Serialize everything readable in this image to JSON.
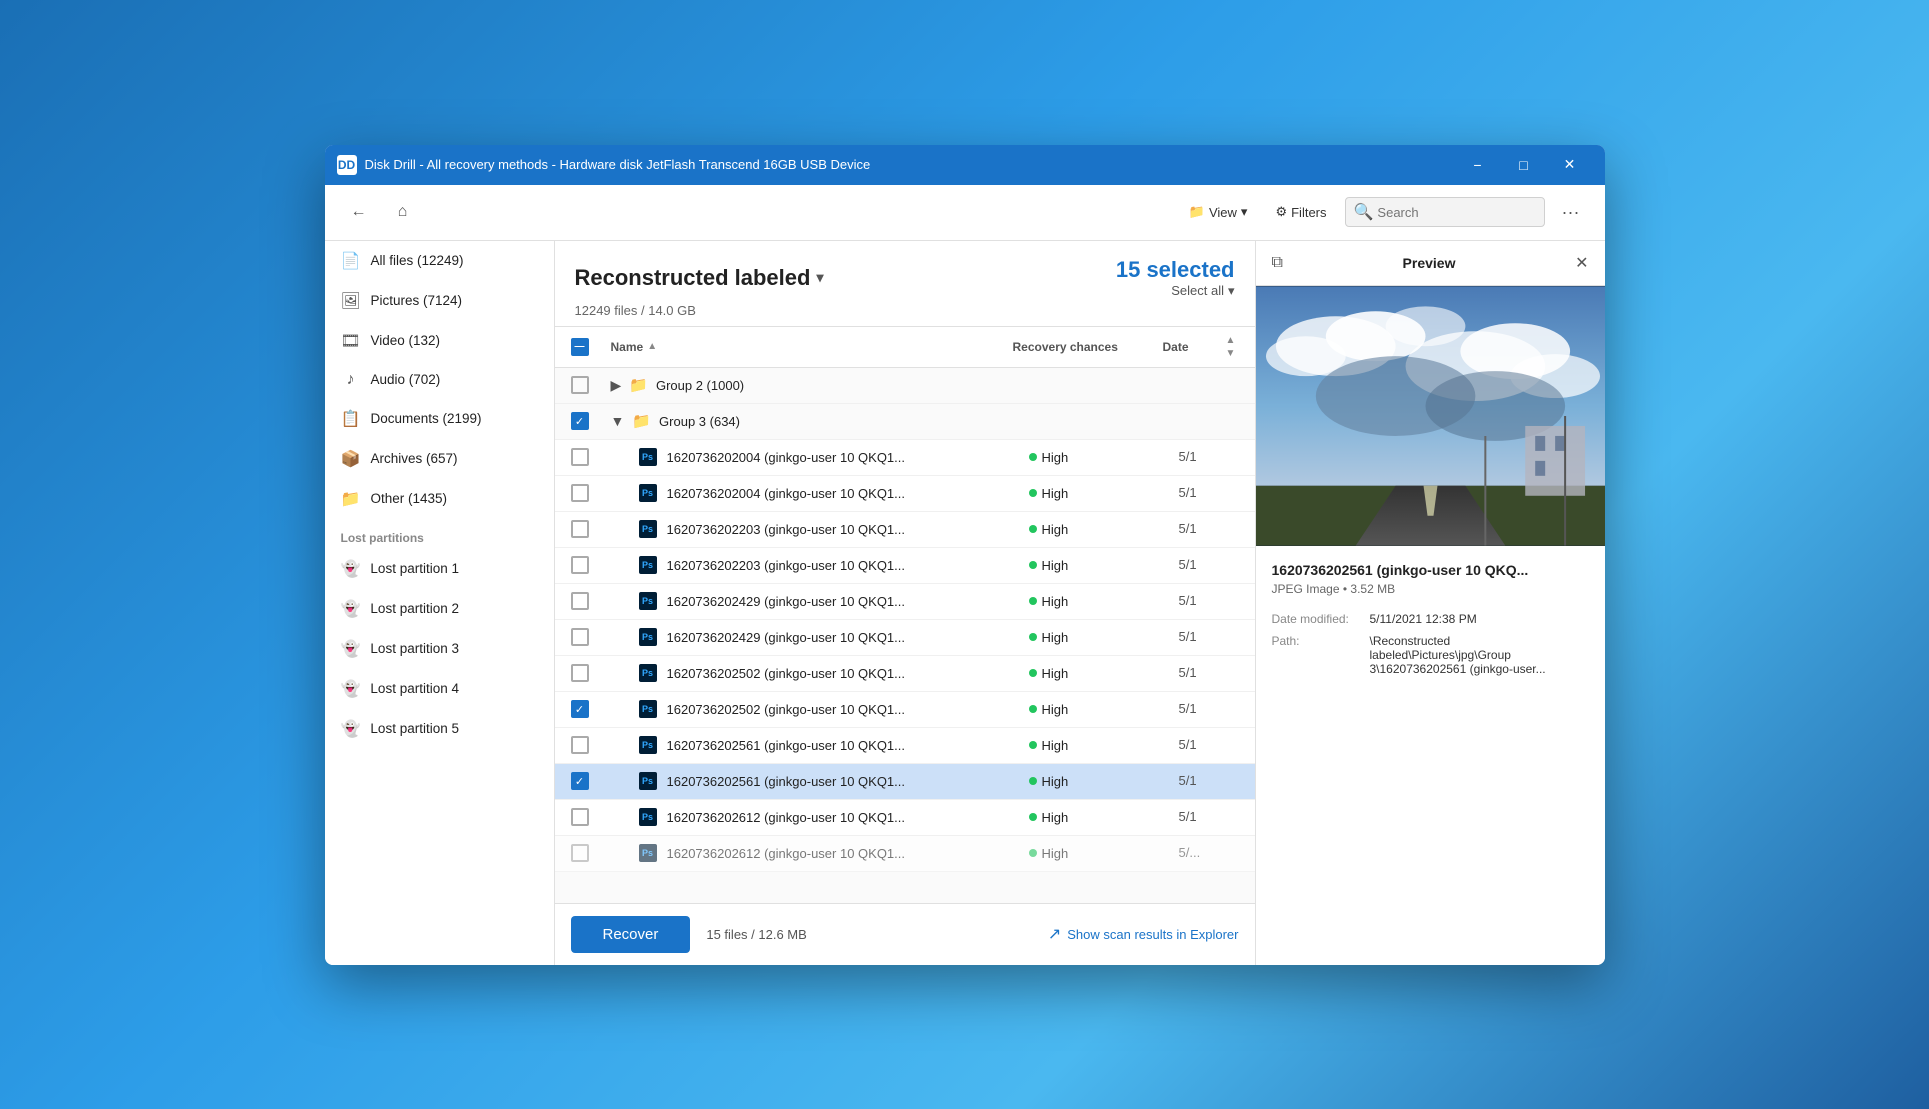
{
  "window": {
    "title": "Disk Drill - All recovery methods - Hardware disk JetFlash Transcend 16GB USB Device",
    "icon_label": "DD"
  },
  "titlebar": {
    "minimize_label": "−",
    "maximize_label": "□",
    "close_label": "✕"
  },
  "toolbar": {
    "back_icon": "←",
    "home_icon": "⌂",
    "view_label": "View",
    "filters_label": "Filters",
    "search_placeholder": "Search",
    "more_icon": "···"
  },
  "sidebar": {
    "items": [
      {
        "label": "All files (12249)",
        "icon": "📄",
        "type": "file"
      },
      {
        "label": "Pictures (7124)",
        "icon": "🖼",
        "type": "picture"
      },
      {
        "label": "Video (132)",
        "icon": "🎞",
        "type": "video"
      },
      {
        "label": "Audio (702)",
        "icon": "♪",
        "type": "audio"
      },
      {
        "label": "Documents (2199)",
        "icon": "📋",
        "type": "doc"
      },
      {
        "label": "Archives (657)",
        "icon": "📦",
        "type": "archive"
      },
      {
        "label": "Other (1435)",
        "icon": "📁",
        "type": "other"
      }
    ],
    "lost_partitions_label": "Lost partitions",
    "lost_partitions": [
      {
        "label": "Lost partition 1",
        "icon": "👻"
      },
      {
        "label": "Lost partition 2",
        "icon": "👻"
      },
      {
        "label": "Lost partition 3",
        "icon": "👻"
      },
      {
        "label": "Lost partition 4",
        "icon": "👻"
      },
      {
        "label": "Lost partition 5",
        "icon": "👻"
      }
    ]
  },
  "content": {
    "folder_title": "Reconstructed labeled",
    "file_count": "12249 files / 14.0 GB",
    "selected_count": "15 selected",
    "select_all_label": "Select all",
    "columns": {
      "name": "Name",
      "recovery": "Recovery chances",
      "date": "Date"
    },
    "groups": [
      {
        "name": "Group 2 (1000)",
        "collapsed": true,
        "files": []
      },
      {
        "name": "Group 3 (634)",
        "collapsed": false,
        "files": [
          {
            "name": "1620736202004 (ginkgo-user 10 QKQ1...",
            "recovery": "High",
            "date": "5/1",
            "checked": false,
            "selected": false
          },
          {
            "name": "1620736202004 (ginkgo-user 10 QKQ1...",
            "recovery": "High",
            "date": "5/1",
            "checked": false,
            "selected": false
          },
          {
            "name": "1620736202203 (ginkgo-user 10 QKQ1...",
            "recovery": "High",
            "date": "5/1",
            "checked": false,
            "selected": false
          },
          {
            "name": "1620736202203 (ginkgo-user 10 QKQ1...",
            "recovery": "High",
            "date": "5/1",
            "checked": false,
            "selected": false
          },
          {
            "name": "1620736202429 (ginkgo-user 10 QKQ1...",
            "recovery": "High",
            "date": "5/1",
            "checked": false,
            "selected": false
          },
          {
            "name": "1620736202429 (ginkgo-user 10 QKQ1...",
            "recovery": "High",
            "date": "5/1",
            "checked": false,
            "selected": false
          },
          {
            "name": "1620736202502 (ginkgo-user 10 QKQ1...",
            "recovery": "High",
            "date": "5/1",
            "checked": false,
            "selected": false
          },
          {
            "name": "1620736202502 (ginkgo-user 10 QKQ1...",
            "recovery": "High",
            "date": "5/1",
            "checked": true,
            "selected": false
          },
          {
            "name": "1620736202561 (ginkgo-user 10 QKQ1...",
            "recovery": "High",
            "date": "5/1",
            "checked": false,
            "selected": false
          },
          {
            "name": "1620736202561 (ginkgo-user 10 QKQ1...",
            "recovery": "High",
            "date": "5/1",
            "checked": true,
            "selected": true
          },
          {
            "name": "1620736202612 (ginkgo-user 10 QKQ1...",
            "recovery": "High",
            "date": "5/1",
            "checked": false,
            "selected": false
          },
          {
            "name": "1620736202612 (ginkgo-user 10 QKQ1...",
            "recovery": "High",
            "date": "5/...",
            "checked": false,
            "selected": false
          }
        ]
      }
    ]
  },
  "bottom_bar": {
    "recover_label": "Recover",
    "files_info": "15 files / 12.6 MB",
    "explorer_label": "Show scan results in Explorer"
  },
  "preview": {
    "title": "Preview",
    "filename": "1620736202561 (ginkgo-user 10 QKQ...",
    "type": "JPEG Image • 3.52 MB",
    "date_modified_label": "Date modified:",
    "date_modified_value": "5/11/2021 12:38 PM",
    "path_label": "Path:",
    "path_value": "\\Reconstructed labeled\\Pictures\\jpg\\Group 3\\1620736202561 (ginkgo-user..."
  },
  "colors": {
    "accent": "#1a73c8",
    "selected_count": "#1a73c8",
    "recover_btn": "#1a73c8",
    "high_dot": "#22c55e",
    "selected_row_bg": "#cce0f8"
  }
}
